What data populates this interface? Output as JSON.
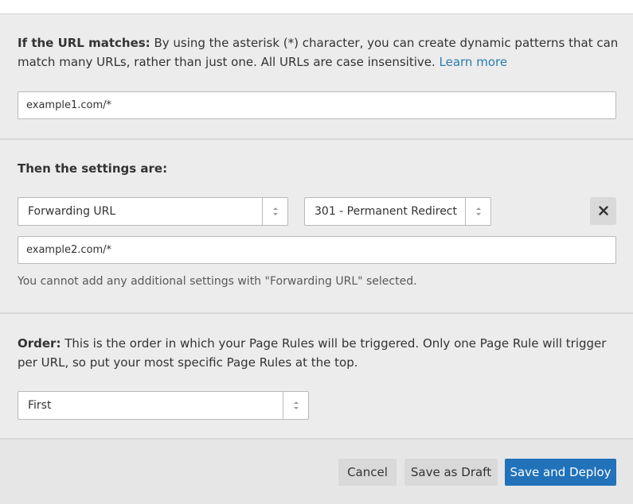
{
  "match_section": {
    "label": "If the URL matches:",
    "description": " By using the asterisk (*) character, you can create dynamic patterns that can match many URLs, rather than just one. All URLs are case insensitive. ",
    "learn_more": "Learn more",
    "url_value": "example1.com/*"
  },
  "settings_section": {
    "heading": "Then the settings are:",
    "setting_select": "Forwarding URL",
    "status_select": "301 - Permanent Redirect",
    "destination_value": "example2.com/*",
    "note": "You cannot add any additional settings with \"Forwarding URL\" selected."
  },
  "order_section": {
    "label": "Order:",
    "description": " This is the order in which your Page Rules will be triggered. Only one Page Rule will trigger per URL, so put your most specific Page Rules at the top.",
    "order_select": "First"
  },
  "footer": {
    "cancel": "Cancel",
    "save_draft": "Save as Draft",
    "save_deploy": "Save and Deploy"
  },
  "colors": {
    "accent": "#2172b9",
    "link": "#2c7cb0"
  }
}
